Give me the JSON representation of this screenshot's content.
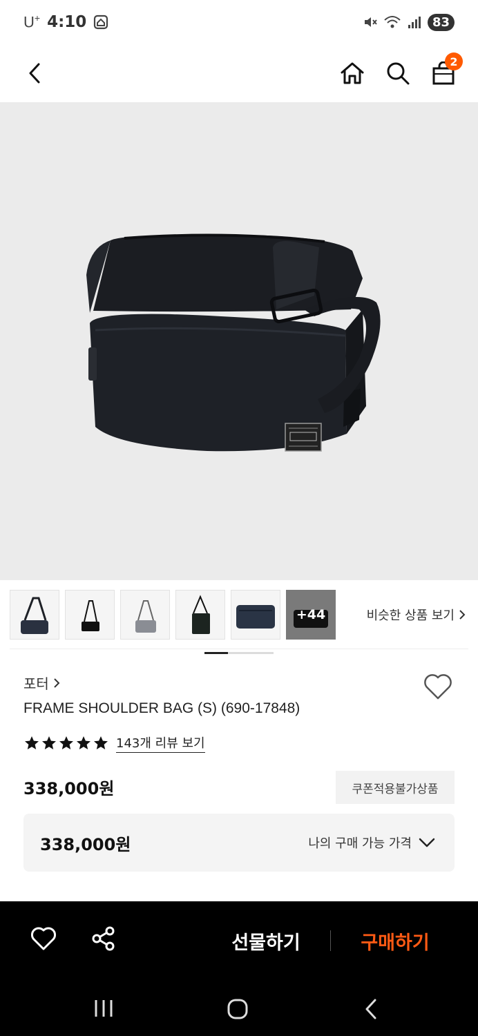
{
  "status_bar": {
    "carrier": "U",
    "carrier_sup": "+",
    "time": "4:10",
    "battery": "83"
  },
  "nav": {
    "cart_count": "2"
  },
  "gallery": {
    "more_count": "+44",
    "similar_link": "비슷한 상품 보기"
  },
  "product": {
    "brand": "포터",
    "title": "FRAME SHOULDER BAG (S) (690-17848)",
    "rating_stars": 5,
    "review_link": "143개 리뷰 보기",
    "price": "338,000원",
    "coupon_badge": "쿠폰적용불가상품",
    "my_price": "338,000원",
    "my_price_label": "나의 구매 가능 가격"
  },
  "action_bar": {
    "gift_label": "선물하기",
    "buy_label": "구매하기"
  },
  "colors": {
    "accent": "#ff5a14",
    "badge": "#ff5a00"
  }
}
